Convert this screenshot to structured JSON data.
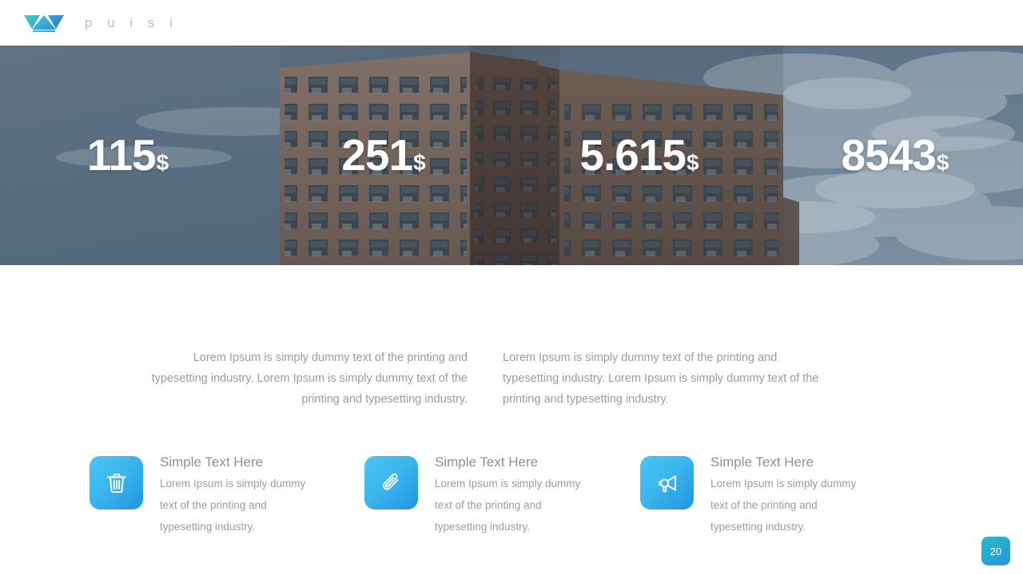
{
  "header": {
    "logo_icon": "triangles-logo-icon",
    "brand_name": "p u i s i"
  },
  "hero": {
    "background_image": "city-brick-apartment-building-sky-photo",
    "stats": [
      {
        "value": "115",
        "unit": "$"
      },
      {
        "value": "251",
        "unit": "$"
      },
      {
        "value": "5.615",
        "unit": "$"
      },
      {
        "value": "8543",
        "unit": "$"
      }
    ]
  },
  "paragraphs": {
    "left": "Lorem Ipsum is simply dummy text of the printing and typesetting industry. Lorem Ipsum is simply dummy text of the printing and typesetting industry.",
    "right": "Lorem Ipsum is simply dummy text of the printing and typesetting industry. Lorem Ipsum is simply dummy text of the printing and typesetting industry."
  },
  "cards": [
    {
      "icon": "trash-icon",
      "title": "Simple Text Here",
      "text": "Lorem Ipsum is simply dummy text of the printing and typesetting industry."
    },
    {
      "icon": "paperclip-icon",
      "title": "Simple Text Here",
      "text": "Lorem Ipsum is simply dummy text of the printing and typesetting industry."
    },
    {
      "icon": "megaphone-icon",
      "title": "Simple Text Here",
      "text": "Lorem Ipsum is simply dummy text of the printing and typesetting industry."
    }
  ],
  "footer": {
    "page_number": "20"
  },
  "colors": {
    "accent_blue": "#2094e2",
    "accent_cyan": "#49c6f2",
    "badge_teal": "#2bbcc6",
    "text_gray": "#9b9b9b",
    "title_gray": "#8f8f8f",
    "brand_gray": "#b9bcc0"
  }
}
